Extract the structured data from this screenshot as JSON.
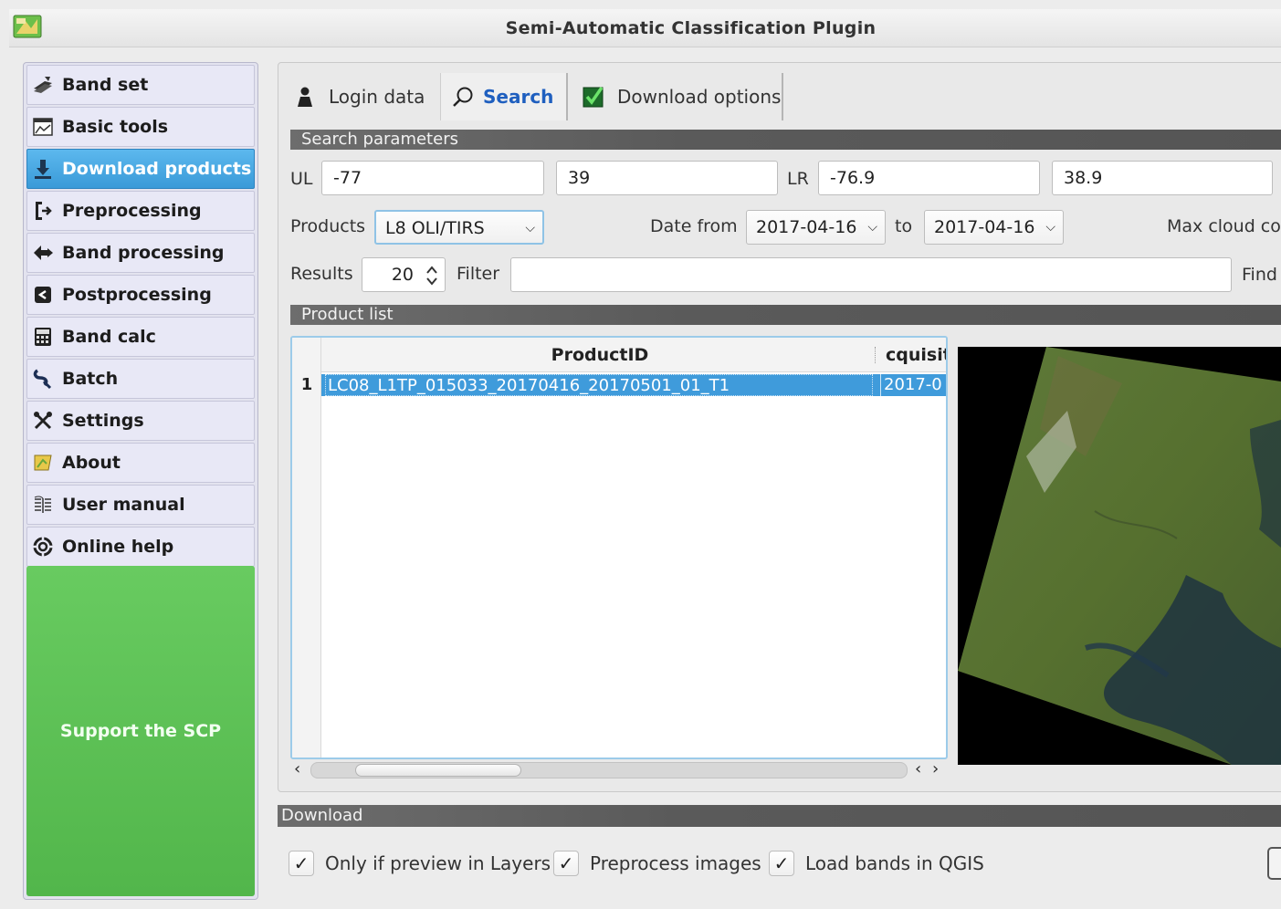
{
  "window": {
    "title": "Semi-Automatic Classification Plugin"
  },
  "sidebar": {
    "items": [
      {
        "label": "Band set",
        "icon": "band-set-icon"
      },
      {
        "label": "Basic tools",
        "icon": "basic-tools-icon"
      },
      {
        "label": "Download products",
        "icon": "download-icon",
        "active": true
      },
      {
        "label": "Preprocessing",
        "icon": "preprocessing-icon"
      },
      {
        "label": "Band processing",
        "icon": "band-processing-icon"
      },
      {
        "label": "Postprocessing",
        "icon": "postprocessing-icon"
      },
      {
        "label": "Band calc",
        "icon": "calculator-icon"
      },
      {
        "label": "Batch",
        "icon": "batch-icon"
      },
      {
        "label": "Settings",
        "icon": "settings-icon"
      },
      {
        "label": "About",
        "icon": "about-icon"
      },
      {
        "label": "User manual",
        "icon": "manual-icon"
      },
      {
        "label": "Online help",
        "icon": "help-icon"
      }
    ],
    "support_label": "Support the SCP"
  },
  "tabs": [
    {
      "label": "Login data",
      "icon": "user-icon"
    },
    {
      "label": "Search",
      "icon": "search-icon",
      "active": true
    },
    {
      "label": "Download options",
      "icon": "checkbox-checked-icon"
    }
  ],
  "search_params": {
    "section_title": "Search parameters",
    "ul_label": "UL",
    "ul_x": "-77",
    "ul_y": "39",
    "lr_label": "LR",
    "lr_x": "-76.9",
    "lr_y": "38.9",
    "products_label": "Products",
    "products_value": "L8 OLI/TIRS",
    "date_from_label": "Date from",
    "date_from": "2017-04-16",
    "to_label": "to",
    "date_to": "2017-04-16",
    "max_cloud_label": "Max cloud co",
    "results_label": "Results",
    "results_value": "20",
    "filter_label": "Filter",
    "filter_value": "",
    "find_label": "Find"
  },
  "product_list": {
    "section_title": "Product list",
    "columns": [
      "ProductID",
      "cquisit"
    ],
    "rows": [
      {
        "num": "1",
        "product_id": "LC08_L1TP_015033_20170416_20170501_01_T1",
        "acquisition": "2017-0"
      }
    ]
  },
  "download": {
    "section_title": "Download",
    "options": [
      {
        "label": "Only if preview in Layers",
        "checked": true
      },
      {
        "label": "Preprocess images",
        "checked": true
      },
      {
        "label": "Load bands in QGIS",
        "checked": true
      }
    ]
  },
  "colors": {
    "accent": "#3f9bdb",
    "support_green": "#5cc055",
    "section_bar": "#5f5f5f"
  }
}
